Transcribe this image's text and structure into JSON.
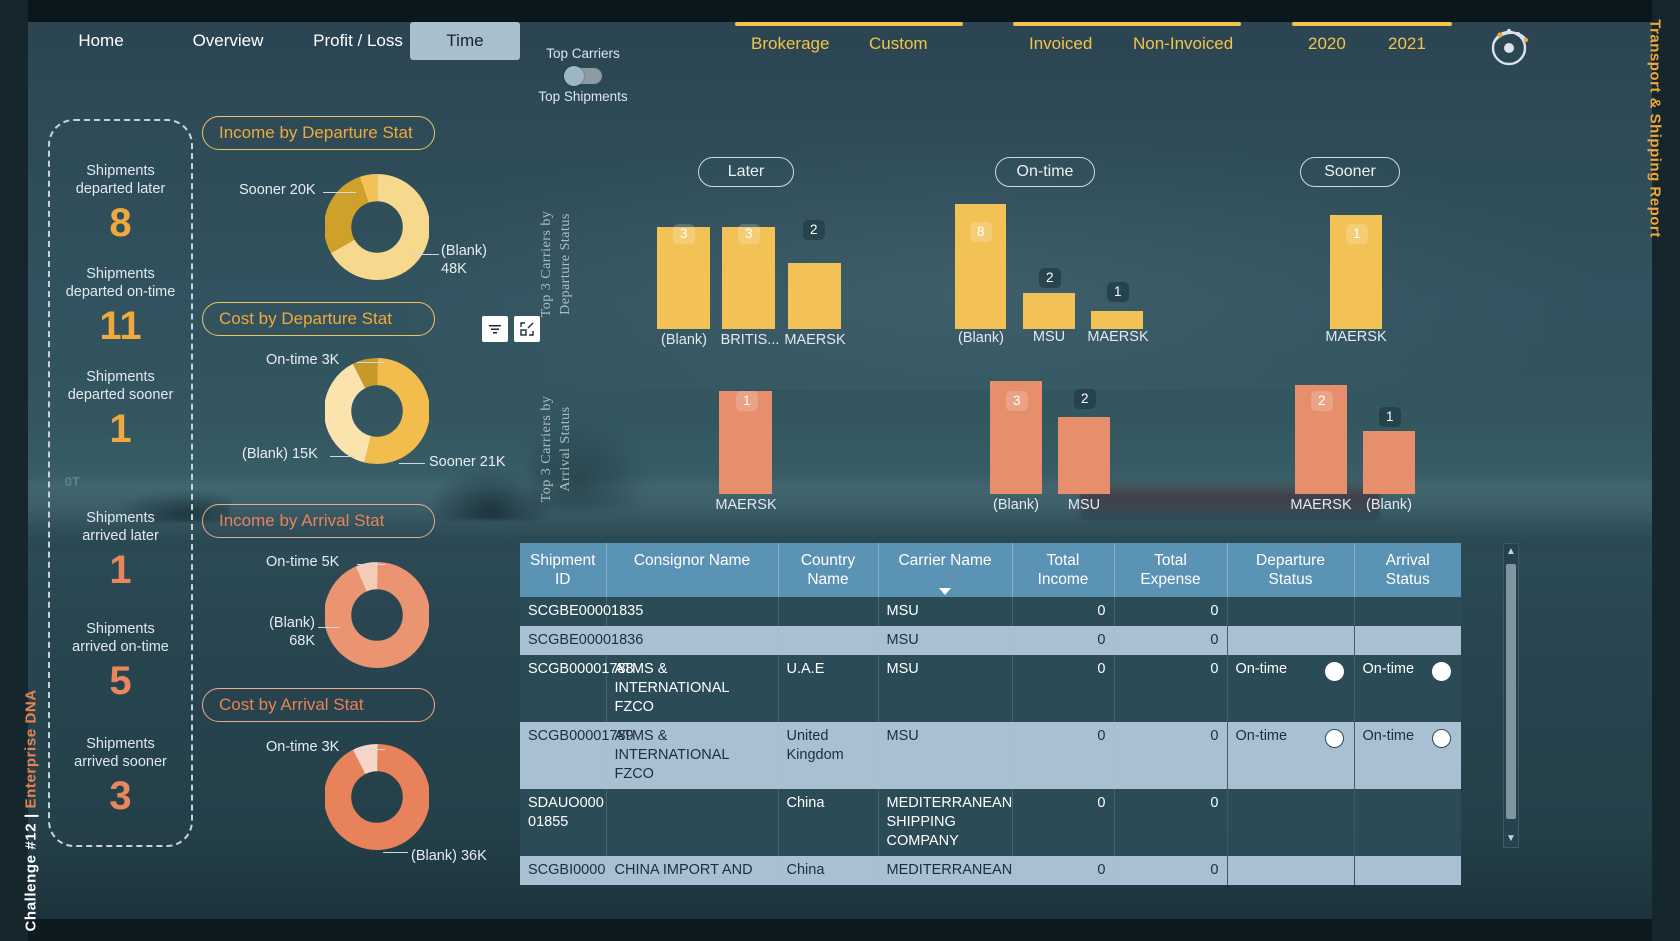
{
  "report": {
    "side_title": "Transport & Shipping Report",
    "challenge_label_white": "Challenge #12  |  ",
    "challenge_label_accent": "Enterprise DNA",
    "challenge_full": "Challenge #12 | Enterprise DNA"
  },
  "nav": {
    "items": [
      {
        "label": "Home",
        "active": false
      },
      {
        "label": "Overview",
        "active": false
      },
      {
        "label": "Profit / Loss",
        "active": false
      },
      {
        "label": "Time",
        "active": true
      }
    ]
  },
  "toggle": {
    "top_label": "Top Carriers",
    "bottom_label": "Top Shipments",
    "state": "Top Carriers"
  },
  "slicers": [
    {
      "name": "type",
      "options": [
        "Brokerage",
        "Custom"
      ]
    },
    {
      "name": "invoice",
      "options": [
        "Invoiced",
        "Non-Invoiced"
      ]
    },
    {
      "name": "year",
      "options": [
        "2020",
        "2021"
      ]
    }
  ],
  "kpis": [
    {
      "label": "Shipments\ndeparted later",
      "line1": "Shipments",
      "line2": "departed later",
      "value": "8",
      "color": "gold"
    },
    {
      "label": "Shipments departed on-time",
      "line1": "Shipments",
      "line2": "departed on-time",
      "value": "11",
      "color": "gold"
    },
    {
      "label": "Shipments departed sooner",
      "line1": "Shipments",
      "line2": "departed sooner",
      "value": "1",
      "color": "gold"
    },
    {
      "label": "Shipments arrived later",
      "line1": "Shipments",
      "line2": "arrived later",
      "value": "1",
      "color": "coral"
    },
    {
      "label": "Shipments arrived on-time",
      "line1": "Shipments",
      "line2": "arrived on-time",
      "value": "5",
      "color": "coral"
    },
    {
      "label": "Shipments arrived sooner",
      "line1": "Shipments",
      "line2": "arrived sooner",
      "value": "3",
      "color": "coral"
    }
  ],
  "ghost_text": "0T",
  "donut_titles": {
    "income_departure": "Income by Departure Stat",
    "cost_departure": "Cost by Departure Stat",
    "income_arrival": "Income by Arrival Stat",
    "cost_arrival": "Cost by Arrival Stat"
  },
  "icon_buttons": [
    {
      "name": "filter-icon",
      "glyph": "≡"
    },
    {
      "name": "focus-mode-icon",
      "glyph": "⤢"
    }
  ],
  "chart_titles": {
    "departure": "Top 3 Carriers by\nDeparture Status",
    "departure_l1": "Top 3 Carriers by",
    "departure_l2": "Departure Status",
    "arrival_l1": "Top 3 Carriers by",
    "arrival_l2": "Arrival Status"
  },
  "chart_data": [
    {
      "type": "pie",
      "name": "income-by-departure-status",
      "title": "Income by Departure Stat",
      "labels": [
        "(Blank)",
        "Sooner",
        "Later"
      ],
      "values": [
        48,
        20,
        4
      ],
      "value_texts": [
        "(Blank) 48K",
        "Sooner 20K",
        ""
      ],
      "colors": [
        "#f6d98c",
        "#cfa12a",
        "#f3c257"
      ],
      "unit": "K"
    },
    {
      "type": "pie",
      "name": "cost-by-departure-status",
      "title": "Cost by Departure Stat",
      "labels": [
        "Sooner",
        "(Blank)",
        "On-time"
      ],
      "values": [
        21,
        15,
        3
      ],
      "value_texts": [
        "Sooner 21K",
        "(Blank) 15K",
        "On-time 3K"
      ],
      "colors": [
        "#f2bd4c",
        "#fae3ad",
        "#c79a28"
      ],
      "unit": "K"
    },
    {
      "type": "pie",
      "name": "income-by-arrival-status",
      "title": "Income by Arrival Stat",
      "labels": [
        "(Blank)",
        "On-time"
      ],
      "values": [
        68,
        5
      ],
      "value_texts": [
        "(Blank) 68K",
        "On-time 5K"
      ],
      "colors": [
        "#eb9472",
        "#f5cbb8"
      ],
      "unit": "K"
    },
    {
      "type": "pie",
      "name": "cost-by-arrival-status",
      "title": "Cost by Arrival Stat",
      "labels": [
        "(Blank)",
        "On-time"
      ],
      "values": [
        36,
        3
      ],
      "value_texts": [
        "(Blank) 36K",
        "On-time 3K"
      ],
      "colors": [
        "#e8825a",
        "#f6d6c6"
      ],
      "unit": "K"
    },
    {
      "type": "bar",
      "name": "top3-carriers-departure-later",
      "title": "Later",
      "categories": [
        "(Blank)",
        "BRITIS...",
        "MAERSK"
      ],
      "values": [
        3,
        3,
        2
      ],
      "ylim": [
        0,
        3
      ],
      "color": "#f3c257"
    },
    {
      "type": "bar",
      "name": "top3-carriers-departure-ontime",
      "title": "On-time",
      "categories": [
        "(Blank)",
        "MSU",
        "MAERSK"
      ],
      "values": [
        8,
        2,
        1
      ],
      "ylim": [
        0,
        8
      ],
      "color": "#f3c257"
    },
    {
      "type": "bar",
      "name": "top3-carriers-departure-sooner",
      "title": "Sooner",
      "categories": [
        "MAERSK"
      ],
      "values": [
        1
      ],
      "ylim": [
        0,
        1
      ],
      "color": "#f3c257"
    },
    {
      "type": "bar",
      "name": "top3-carriers-arrival-later",
      "title": "Later",
      "categories": [
        "MAERSK"
      ],
      "values": [
        1
      ],
      "ylim": [
        0,
        1
      ],
      "color": "#e78f6d"
    },
    {
      "type": "bar",
      "name": "top3-carriers-arrival-ontime",
      "title": "On-time",
      "categories": [
        "(Blank)",
        "MSU"
      ],
      "values": [
        3,
        2
      ],
      "ylim": [
        0,
        3
      ],
      "color": "#e78f6d"
    },
    {
      "type": "bar",
      "name": "top3-carriers-arrival-sooner",
      "title": "Sooner",
      "categories": [
        "MAERSK",
        "(Blank)"
      ],
      "values": [
        2,
        1
      ],
      "ylim": [
        0,
        2
      ],
      "color": "#e78f6d"
    }
  ],
  "status_pills": {
    "later": "Later",
    "ontime": "On-time",
    "sooner": "Sooner"
  },
  "table": {
    "columns": [
      "Shipment ID",
      "Consignor Name",
      "Country Name",
      "Carrier Name",
      "Total Income",
      "Total Expense",
      "Departure Status",
      "Arrival Status"
    ],
    "sorted_column": "Carrier Name",
    "rows": [
      {
        "shipment_id": "SCGBE00001835",
        "consignor": "",
        "country": "",
        "carrier": "MSU",
        "income": "0",
        "expense": "0",
        "departure_status": "",
        "arrival_status": "",
        "departure_dot": false,
        "arrival_dot": false
      },
      {
        "shipment_id": "SCGBE00001836",
        "consignor": "",
        "country": "",
        "carrier": "MSU",
        "income": "0",
        "expense": "0",
        "departure_status": "",
        "arrival_status": "",
        "departure_dot": false,
        "arrival_dot": false
      },
      {
        "shipment_id": "SCGB00001788",
        "consignor": "ATMS & INTERNATIONAL FZCO",
        "country": "U.A.E",
        "carrier": "MSU",
        "income": "0",
        "expense": "0",
        "departure_status": "On-time",
        "arrival_status": "On-time",
        "departure_dot": true,
        "arrival_dot": true
      },
      {
        "shipment_id": "SCGB00001789",
        "consignor": "ATMS & INTERNATIONAL FZCO",
        "country": "United Kingdom",
        "carrier": "MSU",
        "income": "0",
        "expense": "0",
        "departure_status": "On-time",
        "arrival_status": "On-time",
        "departure_dot": true,
        "arrival_dot": true
      },
      {
        "shipment_id": "SDAUO000 01855",
        "consignor": "",
        "country": "China",
        "carrier": "MEDITERRANEAN SHIPPING COMPANY",
        "income": "0",
        "expense": "0",
        "departure_status": "",
        "arrival_status": "",
        "departure_dot": false,
        "arrival_dot": false
      },
      {
        "shipment_id": "SCGBI0000",
        "consignor": "CHINA IMPORT AND",
        "country": "China",
        "carrier": "MEDITERRANEAN",
        "income": "0",
        "expense": "0",
        "departure_status": "",
        "arrival_status": "",
        "departure_dot": false,
        "arrival_dot": false
      }
    ]
  },
  "colors": {
    "gold": "#f3c257",
    "gold_text": "#f0a93c",
    "coral": "#e78f6d",
    "coral_text": "#e8825a",
    "header_blue": "#5b93b5",
    "panel_bg": "#2d4c58",
    "nav_active_bg": "#a9bfcd"
  },
  "scrollbar": {
    "up": "▲",
    "down": "▼"
  }
}
